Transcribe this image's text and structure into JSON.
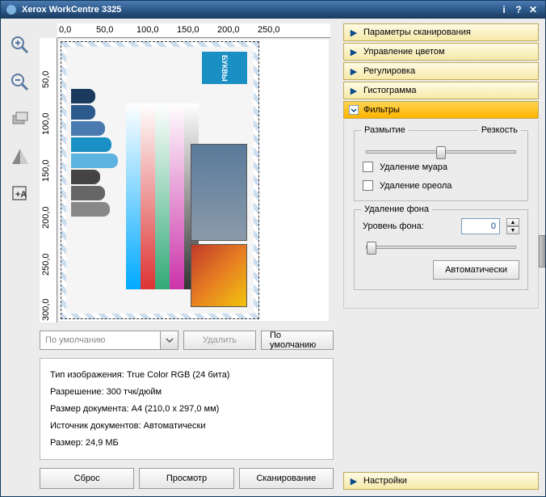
{
  "title": "Xerox WorkCentre 3325",
  "ruler_h": [
    "0,0",
    "50,0",
    "100,0",
    "150,0",
    "200,0",
    "250,0"
  ],
  "ruler_v": [
    "50,0",
    "100,0",
    "150,0",
    "200,0",
    "250,0",
    "300,0"
  ],
  "preset": {
    "combo_value": "По умолчанию",
    "delete": "Удалить",
    "default": "По умолчанию"
  },
  "info": {
    "l1": "Тип изображения: True Color RGB (24 бита)",
    "l2": "Разрешение: 300 тчк/дюйм",
    "l3": "Размер документа: A4 (210,0 x 297,0 мм)",
    "l4": "Источник документов: Автоматически",
    "l5": "Размер: 24,9 МБ"
  },
  "buttons": {
    "reset": "Сброс",
    "preview": "Просмотр",
    "scan": "Сканирование"
  },
  "accordion": {
    "scan_params": "Параметры сканирования",
    "color_mgmt": "Управление цветом",
    "adjust": "Регулировка",
    "histogram": "Гистограмма",
    "filters": "Фильтры",
    "settings": "Настройки"
  },
  "filters": {
    "blur": "Размытие",
    "sharp": "Резкость",
    "moire": "Удаление муара",
    "halo": "Удаление ореола",
    "bg_removal": "Удаление фона",
    "bg_level": "Уровень фона:",
    "bg_value": "0",
    "auto": "Автоматически"
  },
  "preview_text": "БУКВЫ"
}
